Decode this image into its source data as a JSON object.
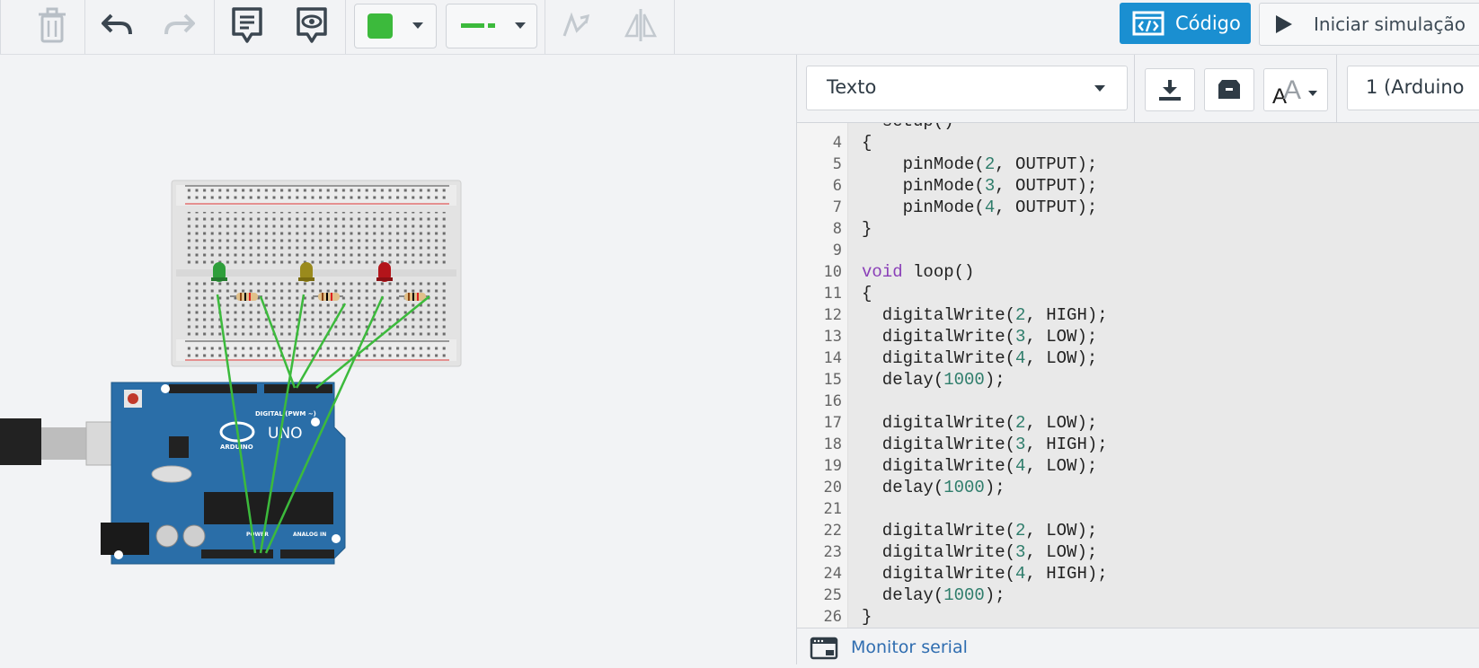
{
  "toolbar": {
    "code_label": "Código",
    "sim_label": "Iniciar simulação",
    "wire_color": "#3cba3c",
    "accent": "#1a8fd1"
  },
  "panel": {
    "mode_selected": "Texto",
    "device_selected": "1 (Arduino",
    "serial_monitor_label": "Monitor serial"
  },
  "editor": {
    "lines": [
      {
        "n": "4",
        "t": "{"
      },
      {
        "n": "5",
        "t": "    pinMode(2, OUTPUT);"
      },
      {
        "n": "6",
        "t": "    pinMode(3, OUTPUT);"
      },
      {
        "n": "7",
        "t": "    pinMode(4, OUTPUT);"
      },
      {
        "n": "8",
        "t": "}"
      },
      {
        "n": "9",
        "t": ""
      },
      {
        "n": "10",
        "t": "void loop()"
      },
      {
        "n": "11",
        "t": "{"
      },
      {
        "n": "12",
        "t": "  digitalWrite(2, HIGH);"
      },
      {
        "n": "13",
        "t": "  digitalWrite(3, LOW);"
      },
      {
        "n": "14",
        "t": "  digitalWrite(4, LOW);"
      },
      {
        "n": "15",
        "t": "  delay(1000);"
      },
      {
        "n": "16",
        "t": ""
      },
      {
        "n": "17",
        "t": "  digitalWrite(2, LOW);"
      },
      {
        "n": "18",
        "t": "  digitalWrite(3, HIGH);"
      },
      {
        "n": "19",
        "t": "  digitalWrite(4, LOW);"
      },
      {
        "n": "20",
        "t": "  delay(1000);"
      },
      {
        "n": "21",
        "t": ""
      },
      {
        "n": "22",
        "t": "  digitalWrite(2, LOW);"
      },
      {
        "n": "23",
        "t": "  digitalWrite(3, LOW);"
      },
      {
        "n": "24",
        "t": "  digitalWrite(4, HIGH);"
      },
      {
        "n": "25",
        "t": "  delay(1000);"
      },
      {
        "n": "26",
        "t": "}"
      }
    ]
  },
  "circuit": {
    "board_name": "UNO",
    "board_brand": "ARDUINO",
    "digital_label": "DIGITAL (PWM ~)",
    "power_label": "POWER",
    "analog_label": "ANALOG IN",
    "led_colors": [
      "#2e9e3a",
      "#9a8a1c",
      "#b3141a"
    ],
    "board_color": "#2a6ea8"
  }
}
